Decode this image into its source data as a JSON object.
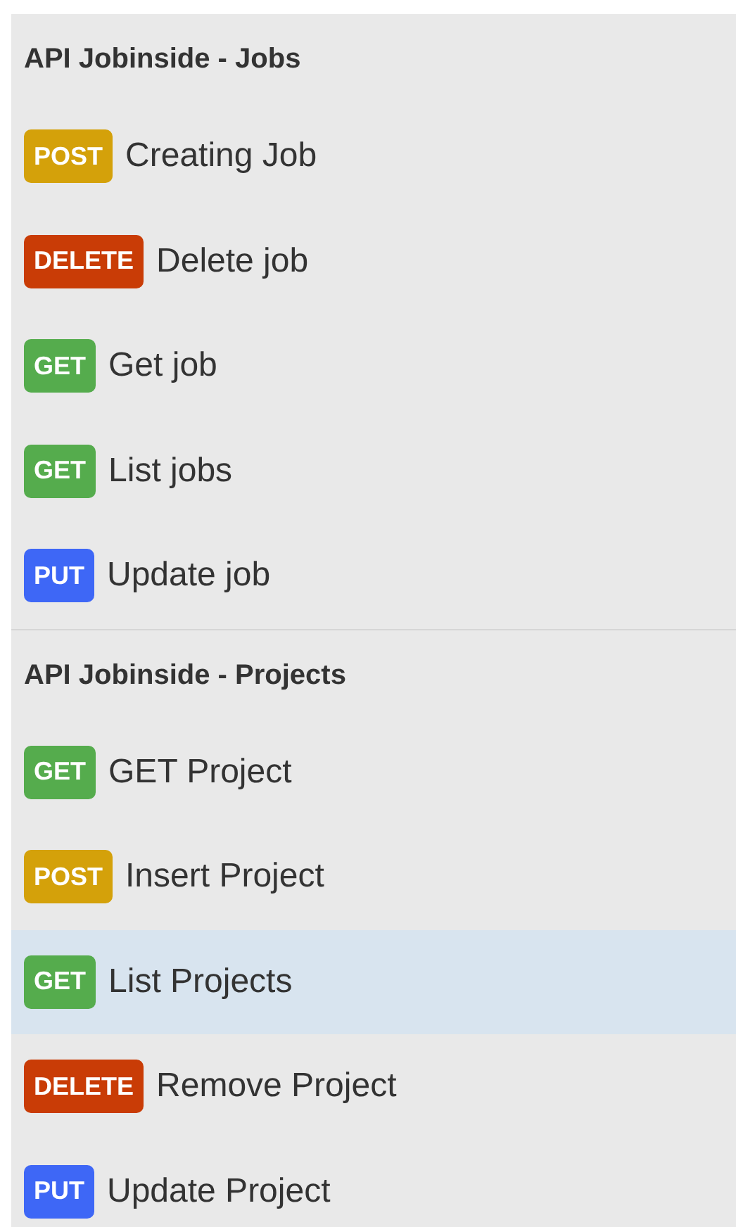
{
  "sections": [
    {
      "title": "API Jobinside - Jobs",
      "endpoints": [
        {
          "kind": "post",
          "method": "POST",
          "name": "Creating Job",
          "selected": false
        },
        {
          "kind": "delete",
          "method": "DELETE",
          "name": "Delete job",
          "selected": false
        },
        {
          "kind": "get",
          "method": "GET",
          "name": "Get job",
          "selected": false
        },
        {
          "kind": "get",
          "method": "GET",
          "name": "List jobs",
          "selected": false
        },
        {
          "kind": "put",
          "method": "PUT",
          "name": "Update job",
          "selected": false
        }
      ]
    },
    {
      "title": "API Jobinside - Projects",
      "endpoints": [
        {
          "kind": "get",
          "method": "GET",
          "name": "GET Project",
          "selected": false
        },
        {
          "kind": "post",
          "method": "POST",
          "name": "Insert Project",
          "selected": false
        },
        {
          "kind": "get",
          "method": "GET",
          "name": "List Projects",
          "selected": true
        },
        {
          "kind": "delete",
          "method": "DELETE",
          "name": "Remove Project",
          "selected": false
        },
        {
          "kind": "put",
          "method": "PUT",
          "name": "Update Project",
          "selected": false
        }
      ]
    }
  ]
}
